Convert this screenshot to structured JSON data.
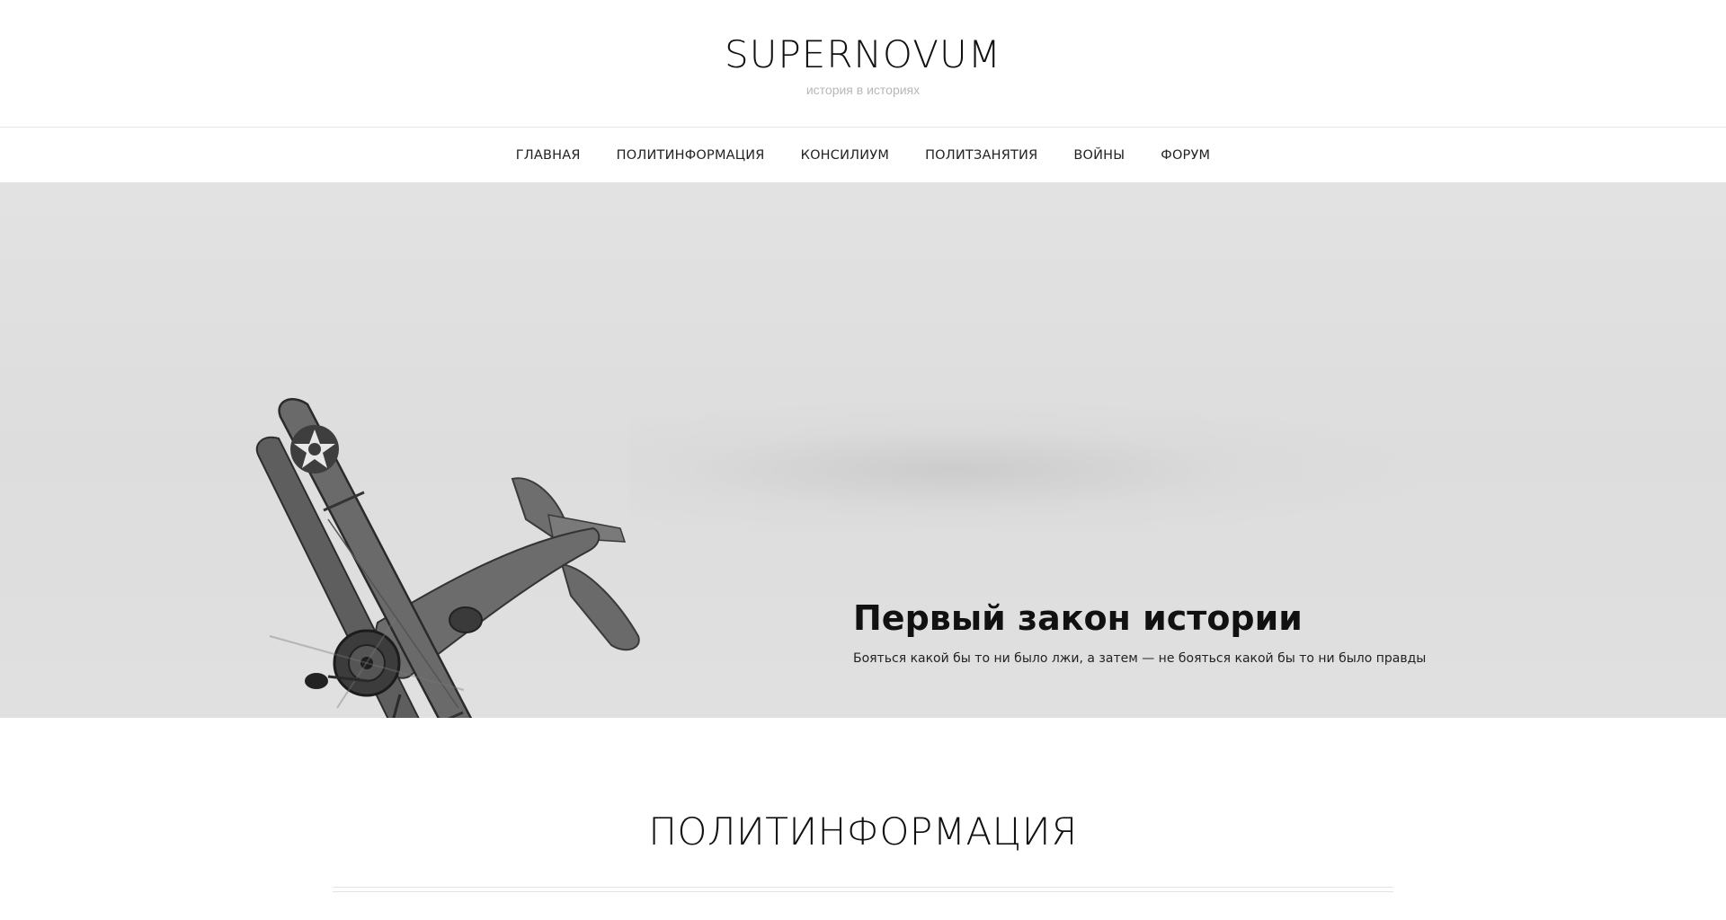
{
  "header": {
    "site_title": "SUPERNOVUM",
    "tagline": "история в историях"
  },
  "nav": {
    "items": [
      {
        "label": "ГЛАВНАЯ"
      },
      {
        "label": "ПОЛИТИНФОРМАЦИЯ"
      },
      {
        "label": "КОНСИЛИУМ"
      },
      {
        "label": "ПОЛИТЗАНЯТИЯ"
      },
      {
        "label": "ВОЙНЫ"
      },
      {
        "label": "ФОРУМ"
      }
    ]
  },
  "hero": {
    "title": "Первый закон истории",
    "subtitle": "Бояться какой бы то ни было лжи, а затем — не бояться какой бы то ни было правды",
    "image": "biplane-photo"
  },
  "section": {
    "title": "ПОЛИТИНФОРМАЦИЯ"
  },
  "colors": {
    "text": "#111111",
    "tagline": "#b8b8b8",
    "hero_bg": "#dedede",
    "divider": "#e6e6e6"
  }
}
